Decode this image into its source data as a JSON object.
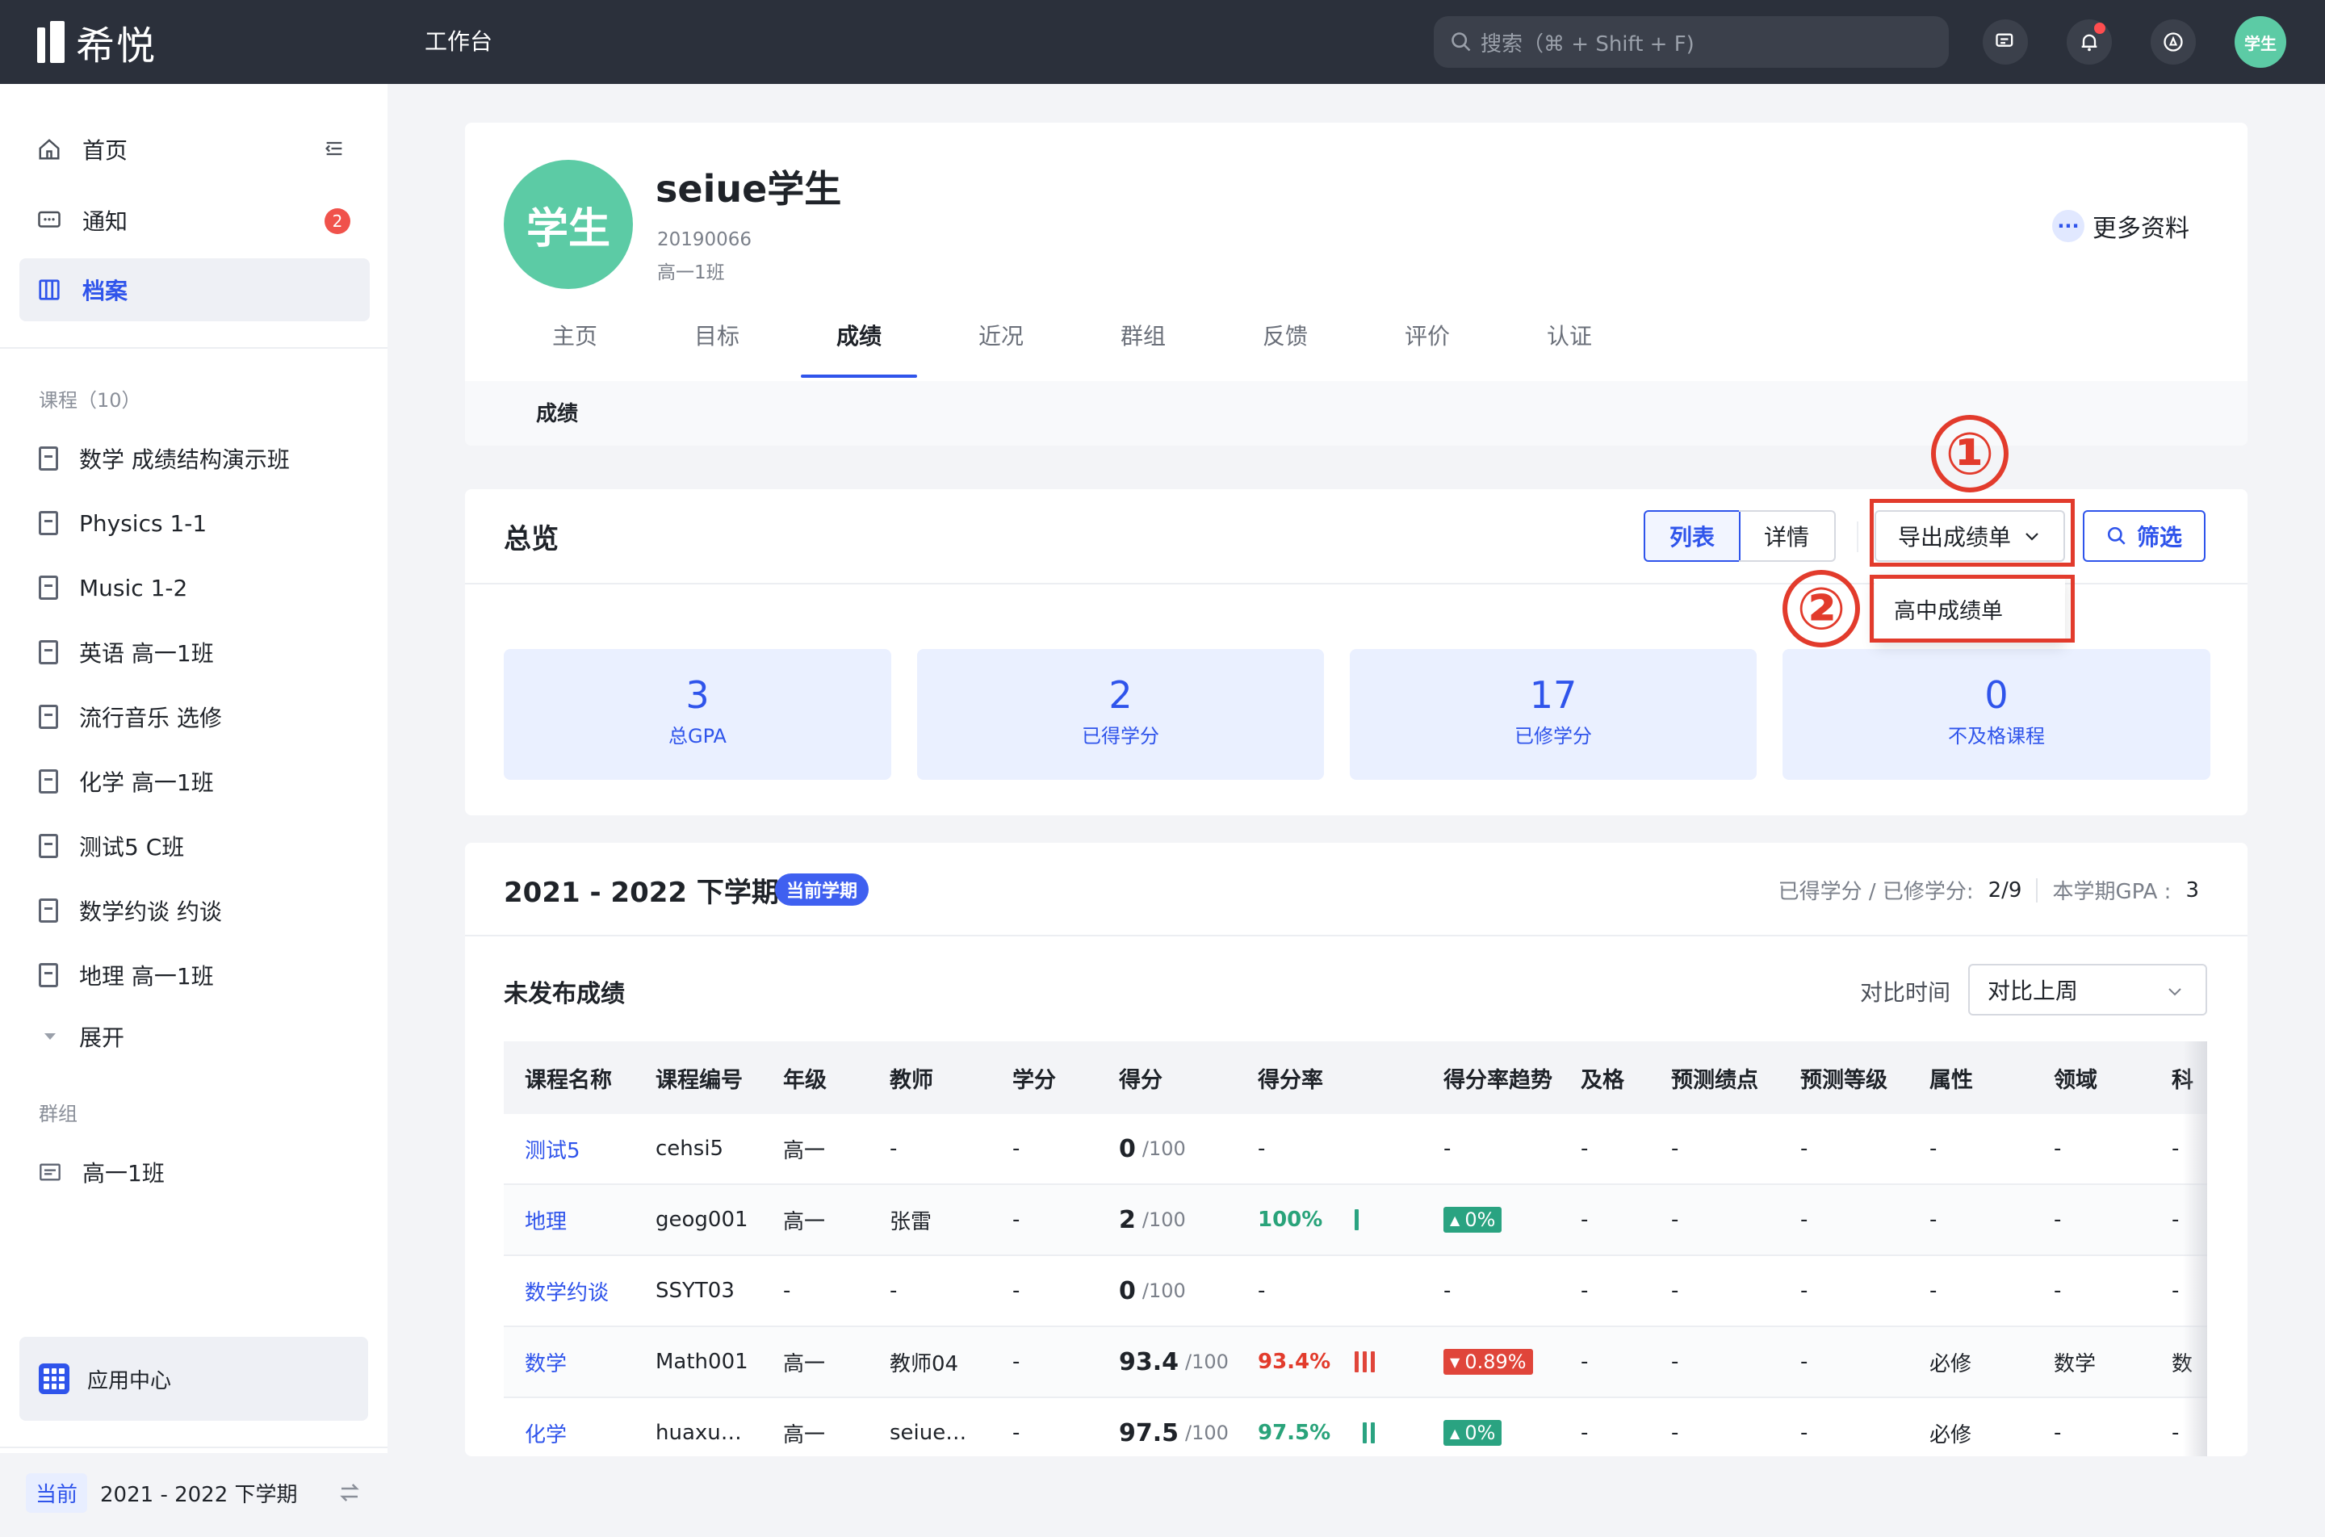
{
  "app": {
    "logo_text": "希悦",
    "workbench": "工作台",
    "search_placeholder": "搜索（⌘ + Shift + F)",
    "user_avatar": "学生"
  },
  "sidebar": {
    "home": "首页",
    "notice": "通知",
    "notice_badge": "2",
    "archive": "档案",
    "courses_title": "课程（10）",
    "courses": [
      "数学 成绩结构演示班",
      "Physics 1-1",
      "Music 1-2",
      "英语 高一1班",
      "流行音乐 选修",
      "化学 高一1班",
      "测试5 C班",
      "数学约谈 约谈",
      "地理 高一1班"
    ],
    "expand": "展开",
    "groups_title": "群组",
    "groups": [
      "高一1班"
    ],
    "app_center": "应用中心",
    "term_tag": "当前",
    "term": "2021 - 2022 下学期"
  },
  "profile": {
    "avatar": "学生",
    "name": "seiue学生",
    "student_id": "20190066",
    "class": "高一1班",
    "more": "更多资料",
    "more_icon": "···",
    "tabs": [
      "主页",
      "目标",
      "成绩",
      "近况",
      "群组",
      "反馈",
      "评价",
      "认证"
    ],
    "active_tab": "成绩",
    "subtab": "成绩"
  },
  "overview": {
    "title": "总览",
    "view_list": "列表",
    "view_detail": "详情",
    "export": "导出成绩单",
    "filter": "筛选",
    "dropdown_item": "高中成绩单",
    "annot_1": "①",
    "annot_2": "②",
    "stats": [
      {
        "value": "3",
        "label": "总GPA"
      },
      {
        "value": "2",
        "label": "已得学分"
      },
      {
        "value": "17",
        "label": "已修学分"
      },
      {
        "value": "0",
        "label": "不及格课程"
      }
    ]
  },
  "term": {
    "title": "2021 - 2022 下学期",
    "badge": "当前学期",
    "credits_label": "已得学分 / 已修学分:",
    "credits_value": "2/9",
    "gpa_label": "本学期GPA :",
    "gpa_value": "3",
    "unpublished": "未发布成绩",
    "compare_label": "对比时间",
    "compare_value": "对比上周"
  },
  "table": {
    "headers": [
      "课程名称",
      "课程编号",
      "年级",
      "教师",
      "学分",
      "得分",
      "得分率",
      "得分率趋势",
      "及格",
      "预测绩点",
      "预测等级",
      "属性",
      "领域",
      "科"
    ],
    "rows": [
      {
        "name": "测试5",
        "code": "cehsi5",
        "grade": "高一",
        "teacher": "-",
        "credit": "-",
        "score": "0",
        "max": "/100",
        "rate": "-",
        "rate_color": "none",
        "bars": 0,
        "trend": "-",
        "trend_dir": "none",
        "pass": "-",
        "gpa": "-",
        "level": "-",
        "attr": "-",
        "field": "-",
        "subject": "-"
      },
      {
        "name": "地理",
        "code": "geog001",
        "grade": "高一",
        "teacher": "张雷",
        "credit": "-",
        "score": "2",
        "max": "/100",
        "rate": "100%",
        "rate_color": "green",
        "bars": 1,
        "trend": "0%",
        "trend_dir": "up",
        "pass": "-",
        "gpa": "-",
        "level": "-",
        "attr": "-",
        "field": "-",
        "subject": "-"
      },
      {
        "name": "数学约谈",
        "code": "SSYT03",
        "grade": "-",
        "teacher": "-",
        "credit": "-",
        "score": "0",
        "max": "/100",
        "rate": "-",
        "rate_color": "none",
        "bars": 0,
        "trend": "-",
        "trend_dir": "none",
        "pass": "-",
        "gpa": "-",
        "level": "-",
        "attr": "-",
        "field": "-",
        "subject": "-"
      },
      {
        "name": "数学",
        "code": "Math001",
        "grade": "高一",
        "teacher": "教师04",
        "credit": "-",
        "score": "93.4",
        "max": "/100",
        "rate": "93.4%",
        "rate_color": "red",
        "bars": 3,
        "trend": "0.89%",
        "trend_dir": "down",
        "pass": "-",
        "gpa": "-",
        "level": "-",
        "attr": "必修",
        "field": "数学",
        "subject": "数"
      },
      {
        "name": "化学",
        "code": "huaxu…",
        "grade": "高一",
        "teacher": "seiue…",
        "credit": "-",
        "score": "97.5",
        "max": "/100",
        "rate": "97.5%",
        "rate_color": "green",
        "bars": 2,
        "trend": "0%",
        "trend_dir": "up",
        "pass": "-",
        "gpa": "-",
        "level": "-",
        "attr": "必修",
        "field": "-",
        "subject": "-"
      }
    ]
  },
  "colors": {
    "accent": "#2f54eb",
    "topbar": "#2b303b",
    "brand_green": "#5ccba5",
    "annotation_red": "#e23b2c",
    "up": "#2aa381",
    "down": "#e0453a"
  }
}
